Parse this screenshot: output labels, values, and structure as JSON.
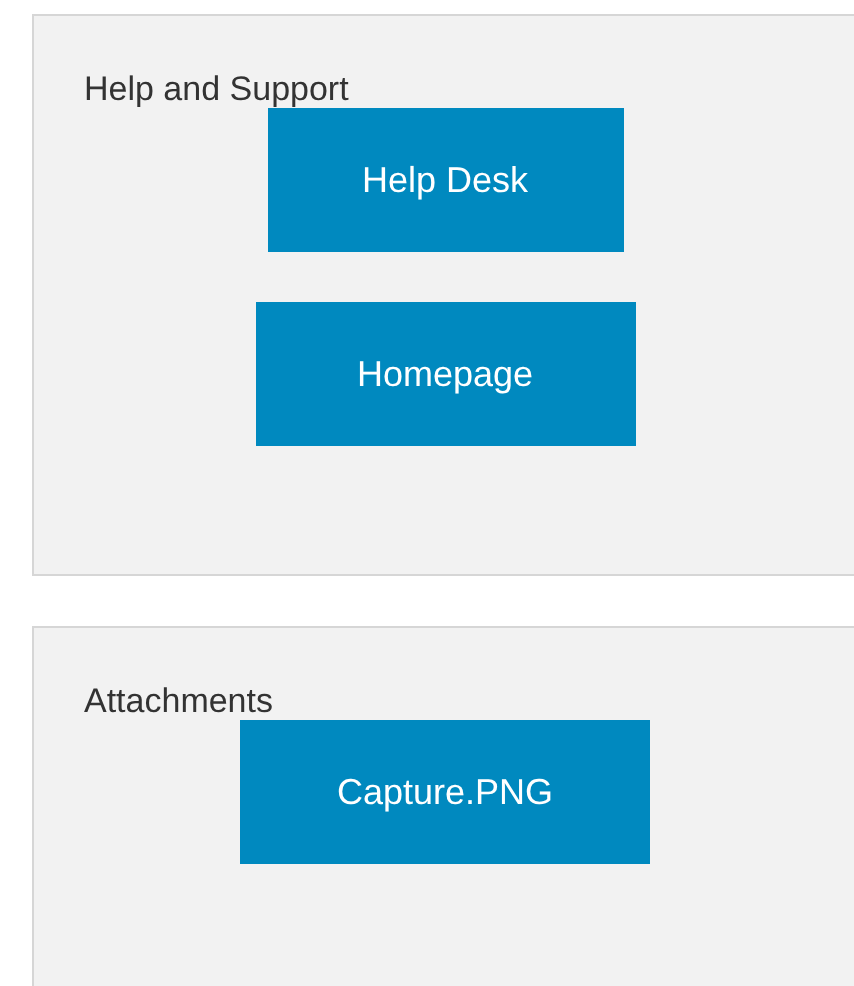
{
  "panels": [
    {
      "title": "Help and Support",
      "buttons": [
        {
          "label": "Help Desk"
        },
        {
          "label": "Homepage"
        }
      ]
    },
    {
      "title": "Attachments",
      "buttons": [
        {
          "label": "Capture.PNG"
        }
      ]
    }
  ]
}
